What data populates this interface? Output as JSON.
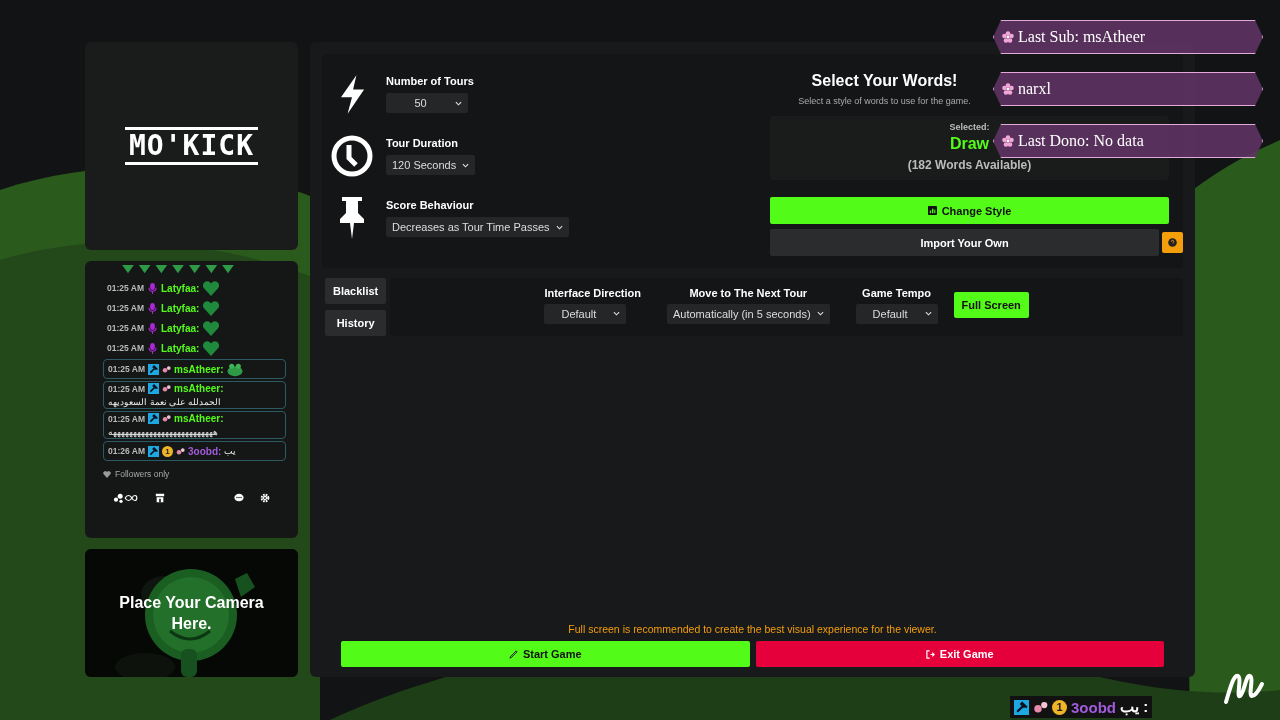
{
  "logo": {
    "text": "MO'KICK"
  },
  "chat": {
    "messages": [
      {
        "kind": "heart",
        "boxed": false,
        "time": "01:25 AM",
        "badges": [
          {
            "kind": "mic"
          }
        ],
        "user": "Latyfaa:",
        "color": "#53fc18"
      },
      {
        "kind": "heart",
        "boxed": false,
        "time": "01:25 AM",
        "badges": [
          {
            "kind": "mic"
          }
        ],
        "user": "Latyfaa:",
        "color": "#53fc18"
      },
      {
        "kind": "heart",
        "boxed": false,
        "time": "01:25 AM",
        "badges": [
          {
            "kind": "mic"
          }
        ],
        "user": "Latyfaa:",
        "color": "#53fc18"
      },
      {
        "kind": "heart",
        "boxed": false,
        "time": "01:25 AM",
        "badges": [
          {
            "kind": "mic"
          }
        ],
        "user": "Latyfaa:",
        "color": "#53fc18"
      },
      {
        "kind": "frog",
        "boxed": true,
        "time": "01:25 AM",
        "badges": [
          {
            "kind": "mod"
          },
          {
            "kind": "gift"
          }
        ],
        "user": "msAtheer:",
        "color": "#53fc18"
      },
      {
        "kind": "text",
        "boxed": true,
        "time": "01:25 AM",
        "badges": [
          {
            "kind": "mod"
          },
          {
            "kind": "gift"
          }
        ],
        "user": "msAtheer:",
        "color": "#53fc18",
        "text": "الحمدلله على نعمة السعوديهه"
      },
      {
        "kind": "text",
        "boxed": true,
        "time": "01:25 AM",
        "badges": [
          {
            "kind": "mod"
          },
          {
            "kind": "gift"
          }
        ],
        "user": "msAtheer:",
        "color": "#53fc18",
        "text": "ههههههههههههههههههههههههههه"
      },
      {
        "kind": "text",
        "boxed": true,
        "time": "01:26 AM",
        "badges": [
          {
            "kind": "mod"
          },
          {
            "kind": "sub",
            "text": "1"
          },
          {
            "kind": "gift"
          }
        ],
        "user": "3oobd:",
        "color": "#a25bdc",
        "text": "يب"
      }
    ],
    "followers_only": "Followers only"
  },
  "camera": {
    "text": "Place Your Camera Here."
  },
  "settings": [
    {
      "kind": "bolt",
      "label": "Number of Tours",
      "value": "50"
    },
    {
      "kind": "clock",
      "label": "Tour Duration",
      "value": "120 Seconds"
    },
    {
      "kind": "pin",
      "label": "Score Behaviour",
      "value": "Decreases as Tour Time Passes"
    }
  ],
  "words": {
    "title": "Select Your Words!",
    "subtitle": "Select a style of words to use for the game.",
    "selected_label": "Selected:",
    "selected": "Draw",
    "count": "(182 Words Available)",
    "change_button": "Change Style",
    "import_button": "Import Your Own"
  },
  "side_buttons": [
    "Blacklist",
    "History"
  ],
  "options": [
    {
      "label": "Interface Direction",
      "value": "Default"
    },
    {
      "label": "Move to The Next Tour",
      "value": "Automatically (in 5 seconds)"
    },
    {
      "label": "Game Tempo",
      "value": "Default"
    }
  ],
  "fullscreen_button": "Full Screen",
  "notice": "Full screen is recommended to create the best visual experience for the viewer.",
  "start_button": "Start Game",
  "exit_button": "Exit Game",
  "alerts": [
    "Last Sub: msAtheer",
    "narxl",
    "Last Dono: No data"
  ],
  "overlay_message": {
    "badges": [
      {
        "kind": "mod"
      },
      {
        "kind": "gift"
      },
      {
        "kind": "sub",
        "text": "1"
      }
    ],
    "user": "3oobd",
    "text": "يب :",
    "color": "#a25bdc"
  }
}
